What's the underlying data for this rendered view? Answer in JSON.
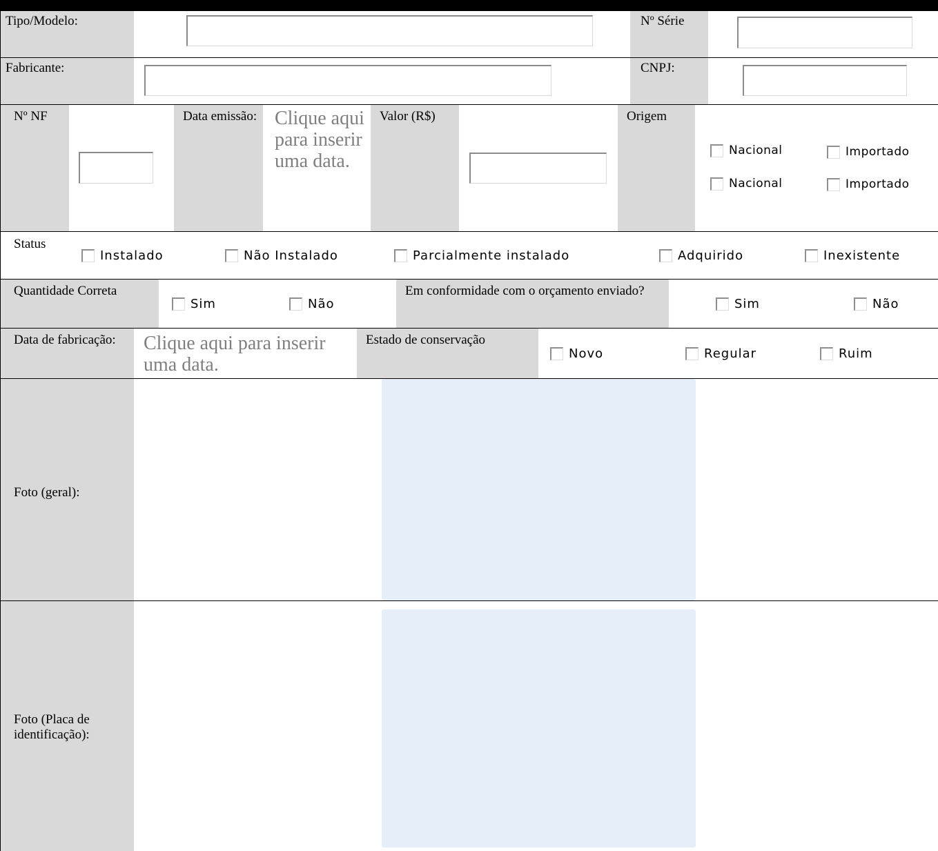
{
  "fields": {
    "tipo_modelo": "Tipo/Modelo:",
    "numero_serie": "Nº Série",
    "fabricante": "Fabricante:",
    "cnpj": "CNPJ:",
    "numero_nf": "Nº NF",
    "data_emissao": "Data emissão:",
    "data_emissao_placeholder": "Clique aqui para inserir uma data.",
    "valor": "Valor (R$)",
    "origem": "Origem",
    "status": "Status",
    "quantidade_correta": "Quantidade Correta",
    "conformidade": "Em conformidade com o orçamento enviado?",
    "data_fabricacao": "Data de fabricação:",
    "data_fabricacao_placeholder": "Clique aqui para inserir uma data.",
    "estado_conservacao": "Estado de conservação",
    "foto_geral": "Foto (geral):",
    "foto_placa": "Foto (Placa de identificação):"
  },
  "origem_options": {
    "row1": [
      "Nacional",
      "Importado"
    ],
    "row2": [
      "Nacional",
      "Importado"
    ]
  },
  "status_options": [
    "Instalado",
    "Não Instalado",
    "Parcialmente instalado",
    "Adquirido",
    "Inexistente"
  ],
  "quantidade_options": [
    "Sim",
    "Não"
  ],
  "conformidade_options": [
    "Sim",
    "Não"
  ],
  "estado_options": [
    "Novo",
    "Regular",
    "Ruim"
  ],
  "colors": {
    "label_bg": "#d9d9d9",
    "photo_bg": "#e6eefa",
    "placeholder": "#7f7f7f"
  }
}
